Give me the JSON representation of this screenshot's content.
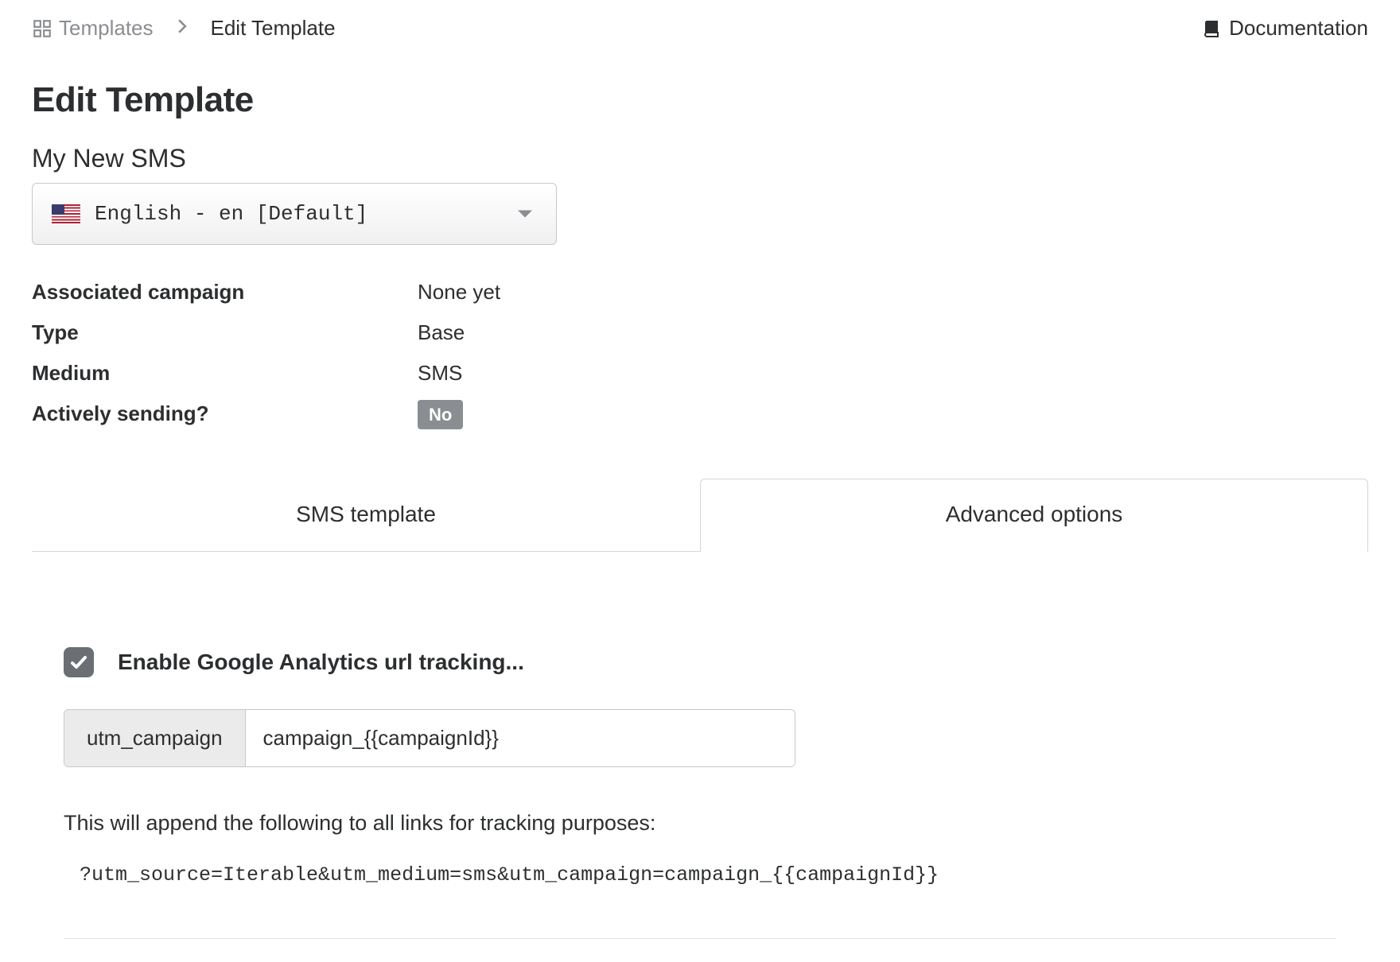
{
  "header": {
    "breadcrumb": {
      "root": "Templates",
      "current": "Edit Template"
    },
    "documentation": "Documentation"
  },
  "page": {
    "title": "Edit Template",
    "template_name": "My New SMS",
    "locale_selected": "English - en [Default]"
  },
  "meta": {
    "associated_campaign": {
      "label": "Associated campaign",
      "value": "None yet"
    },
    "type": {
      "label": "Type",
      "value": "Base"
    },
    "medium": {
      "label": "Medium",
      "value": "SMS"
    },
    "actively_sending": {
      "label": "Actively sending?",
      "value": "No"
    }
  },
  "tabs": {
    "sms_template": "SMS template",
    "advanced_options": "Advanced options"
  },
  "advanced": {
    "ga_checkbox_label": "Enable Google Analytics url tracking...",
    "utm_addon": "utm_campaign",
    "utm_value": "campaign_{{campaignId}}",
    "helper_text": "This will append the following to all links for tracking purposes:",
    "code_line": "?utm_source=Iterable&utm_medium=sms&utm_campaign=campaign_{{campaignId}}"
  }
}
